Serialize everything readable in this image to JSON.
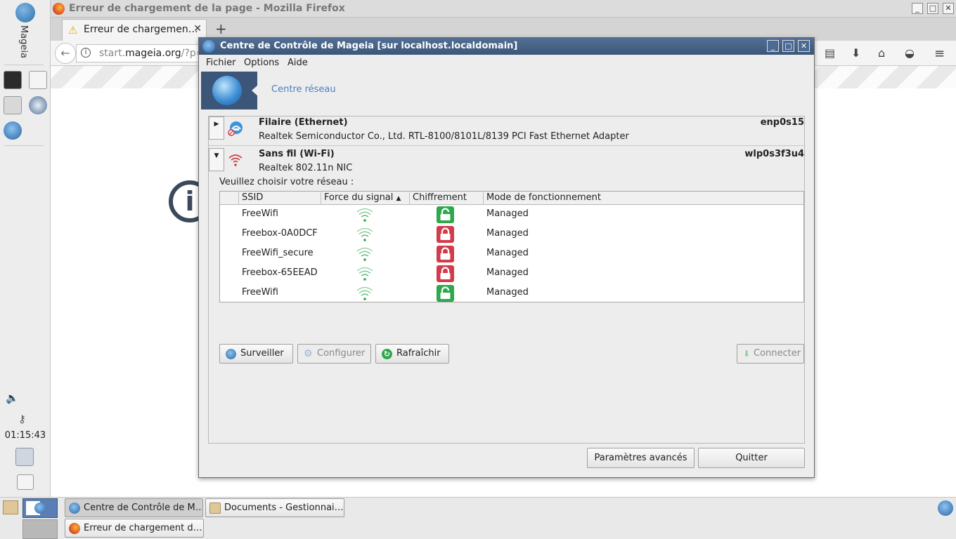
{
  "desktop": {
    "launcher_label": "Mageia",
    "clock": "01:15:43"
  },
  "firefox": {
    "window_title": "Erreur de chargement de la page - Mozilla Firefox",
    "tab_title": "Erreur de chargemen…",
    "url_prefix": "start.",
    "url_domain": "mageia.org",
    "url_suffix": "/?p=",
    "info_glyph": "i",
    "error_glyph": "i"
  },
  "mcc": {
    "title": "Centre de Contrôle de Mageia  [sur localhost.localdomain]",
    "menu": {
      "file": "Fichier",
      "options": "Options",
      "help": "Aide"
    },
    "section_title": "Centre réseau",
    "networks": [
      {
        "type": "Filaire (Ethernet)",
        "device": "enp0s15",
        "description": "Realtek Semiconductor Co., Ltd. RTL-8100/8101L/8139 PCI Fast Ethernet Adapter",
        "expanded": false
      },
      {
        "type": "Sans fil (Wi-Fi)",
        "device": "wlp0s3f3u4",
        "description": "Realtek  802.11n NIC",
        "expanded": true
      }
    ],
    "choose_label": "Veuillez choisir votre réseau :",
    "table": {
      "columns": [
        "SSID",
        "Force du signal",
        "Chiffrement",
        "Mode de fonctionnement"
      ],
      "sort_column": "Force du signal",
      "rows": [
        {
          "ssid": "FreeWifi",
          "encrypted": false,
          "mode": "Managed"
        },
        {
          "ssid": "Freebox-0A0DCF",
          "encrypted": true,
          "mode": "Managed"
        },
        {
          "ssid": "FreeWifi_secure",
          "encrypted": true,
          "mode": "Managed"
        },
        {
          "ssid": "Freebox-65EEAD",
          "encrypted": true,
          "mode": "Managed"
        },
        {
          "ssid": "FreeWifi",
          "encrypted": false,
          "mode": "Managed"
        }
      ]
    },
    "buttons": {
      "monitor": "Surveiller",
      "configure": "Configurer",
      "refresh": "Rafraîchir",
      "connect": "Connecter",
      "advanced": "Paramètres avancés",
      "quit": "Quitter"
    }
  },
  "taskbar": {
    "items": [
      "Centre de Contrôle de M…",
      "Documents - Gestionnai…",
      "Erreur de chargement d…"
    ]
  },
  "colors": {
    "accent": "#4a7fc1",
    "title_bar": "#3b5678",
    "lock_open": "#2ea84d",
    "lock_closed": "#d43b4a",
    "wifi_signal": "#2ea84d"
  }
}
